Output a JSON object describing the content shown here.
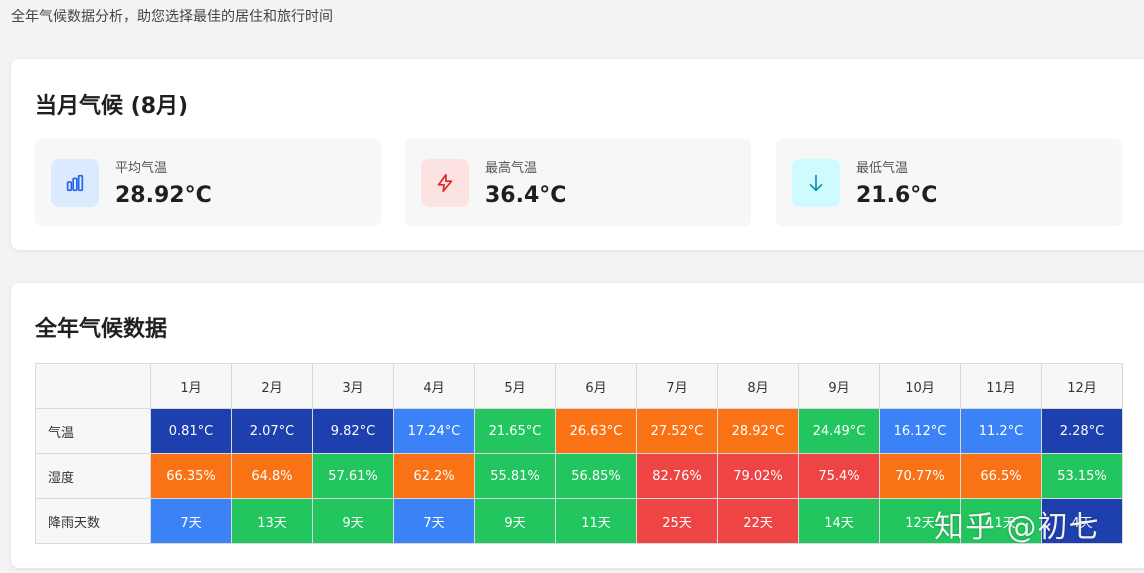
{
  "subtitle": "全年气候数据分析，助您选择最佳的居住和旅行时间",
  "current": {
    "title": "当月气候 (8月)",
    "stats": [
      {
        "label": "平均气温",
        "value": "28.92°C",
        "icon": "bar-chart-icon",
        "icon_bg": "#dbeafe",
        "icon_color": "#2563eb"
      },
      {
        "label": "最高气温",
        "value": "36.4°C",
        "icon": "lightning-icon",
        "icon_bg": "#fde2e2",
        "icon_color": "#dc2626"
      },
      {
        "label": "最低气温",
        "value": "21.6°C",
        "icon": "arrow-down-icon",
        "icon_bg": "#cffafe",
        "icon_color": "#0891b2"
      }
    ]
  },
  "year": {
    "title": "全年气候数据",
    "months": [
      "1月",
      "2月",
      "3月",
      "4月",
      "5月",
      "6月",
      "7月",
      "8月",
      "9月",
      "10月",
      "11月",
      "12月"
    ],
    "rows": [
      {
        "label": "气温",
        "values": [
          "0.81°C",
          "2.07°C",
          "9.82°C",
          "17.24°C",
          "21.65°C",
          "26.63°C",
          "27.52°C",
          "28.92°C",
          "24.49°C",
          "16.12°C",
          "11.2°C",
          "2.28°C"
        ],
        "colors": [
          "#1e40af",
          "#1e40af",
          "#1e40af",
          "#3b82f6",
          "#22c55e",
          "#f97316",
          "#f97316",
          "#f97316",
          "#22c55e",
          "#3b82f6",
          "#3b82f6",
          "#1e40af"
        ]
      },
      {
        "label": "湿度",
        "values": [
          "66.35%",
          "64.8%",
          "57.61%",
          "62.2%",
          "55.81%",
          "56.85%",
          "82.76%",
          "79.02%",
          "75.4%",
          "70.77%",
          "66.5%",
          "53.15%"
        ],
        "colors": [
          "#f97316",
          "#f97316",
          "#22c55e",
          "#f97316",
          "#22c55e",
          "#22c55e",
          "#ef4444",
          "#ef4444",
          "#ef4444",
          "#f97316",
          "#f97316",
          "#22c55e"
        ]
      },
      {
        "label": "降雨天数",
        "values": [
          "7天",
          "13天",
          "9天",
          "7天",
          "9天",
          "11天",
          "25天",
          "22天",
          "14天",
          "12天",
          "11天",
          "4天"
        ],
        "colors": [
          "#3b82f6",
          "#22c55e",
          "#22c55e",
          "#3b82f6",
          "#22c55e",
          "#22c55e",
          "#ef4444",
          "#ef4444",
          "#22c55e",
          "#22c55e",
          "#22c55e",
          "#1e40af"
        ]
      }
    ]
  },
  "watermark": "知乎 @初七"
}
